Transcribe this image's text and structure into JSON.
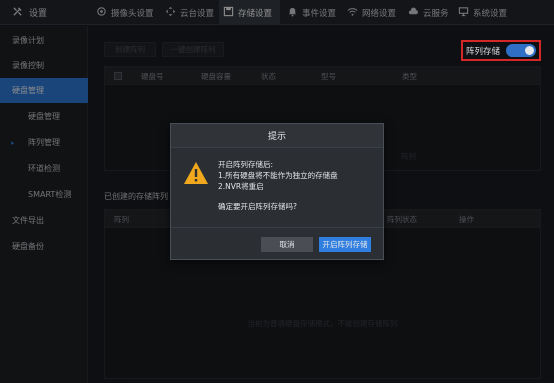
{
  "topbar": {
    "title": "设置",
    "tabs": [
      {
        "label": "摄像头设置",
        "icon": "camera-icon"
      },
      {
        "label": "云台设置",
        "icon": "ptz-icon"
      },
      {
        "label": "存储设置",
        "icon": "save-icon",
        "active": true
      },
      {
        "label": "事件设置",
        "icon": "bell-icon"
      },
      {
        "label": "网络设置",
        "icon": "wifi-icon"
      },
      {
        "label": "云服务",
        "icon": "cloud-icon"
      },
      {
        "label": "系统设置",
        "icon": "monitor-icon"
      }
    ]
  },
  "sidebar": {
    "items": [
      {
        "label": "录像计划"
      },
      {
        "label": "录像控制"
      },
      {
        "label": "硬盘管理",
        "active": true
      },
      {
        "label": "硬盘管理"
      },
      {
        "label": "阵列管理"
      },
      {
        "label": "环道检测"
      },
      {
        "label": "SMART检测"
      },
      {
        "label": "文件导出"
      },
      {
        "label": "硬盘备份"
      }
    ]
  },
  "main": {
    "create_array_label": "创建阵列",
    "one_click_create_label": "一键创建阵列",
    "array_storage_label": "阵列存储",
    "array_storage_on": true,
    "disk_table": {
      "headers": [
        "硬盘号",
        "硬盘容量",
        "状态",
        "型号",
        "类型"
      ],
      "partial_text": "阵列"
    },
    "created_label": "已创建的存储阵列",
    "array_table": {
      "headers": [
        "阵列",
        "阵列状态",
        "操作"
      ],
      "empty_message": "当前为普通硬盘存储模式，不能创建存储阵列"
    }
  },
  "modal": {
    "title": "提示",
    "lines": [
      "开启阵列存储后:",
      "1.所有硬盘将不能作为独立的存储盘",
      "2.NVR将重启",
      "确定要开启阵列存储吗?"
    ],
    "cancel_label": "取消",
    "confirm_label": "开启阵列存储"
  },
  "colors": {
    "accent": "#2f7ee0",
    "highlight_border": "#d62728",
    "warning": "#f0a81c"
  }
}
